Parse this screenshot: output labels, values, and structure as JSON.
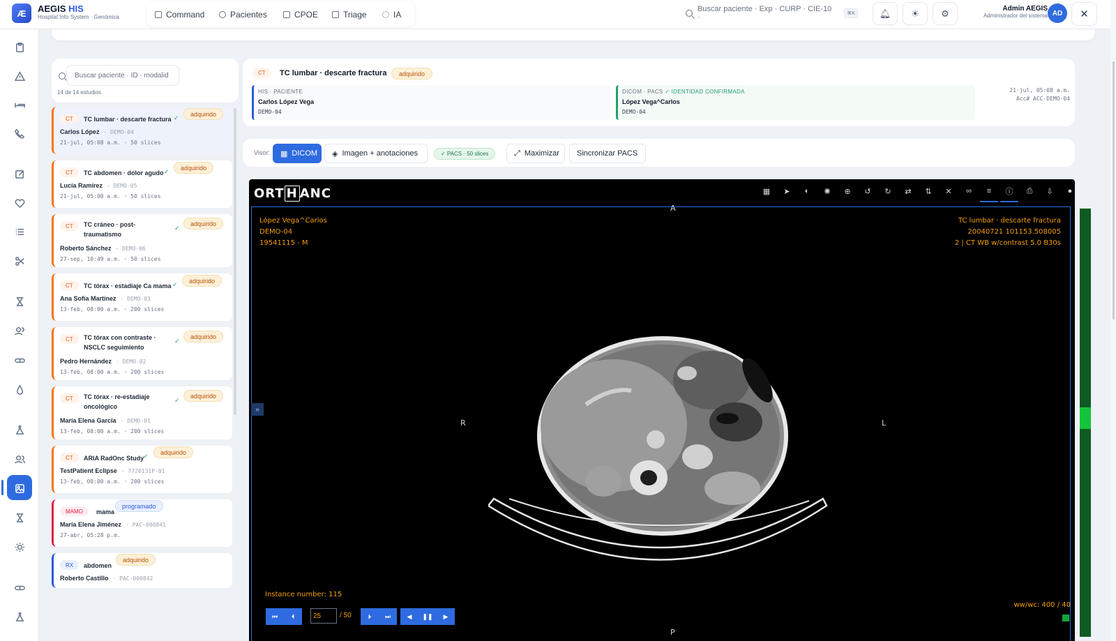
{
  "app": {
    "logo_mark": "Æ",
    "name_prefix": "AEGIS",
    "name_suffix": "HIS",
    "subtitle": "Hospital Info System · Genómica"
  },
  "nav_tabs": [
    {
      "label": "Command"
    },
    {
      "label": "Pacientes"
    },
    {
      "label": "CPOE"
    },
    {
      "label": "Triage"
    },
    {
      "label": "IA"
    }
  ],
  "search": {
    "placeholder": "Buscar paciente · Exp · CURP · CIE-10 ·",
    "shortcut": "⌘K"
  },
  "user": {
    "name": "Admin AEGIS",
    "role": "Administrador del sistema",
    "initials": "AD"
  },
  "close_label": "✕",
  "rail_icons": [
    "clipboard-icon",
    "alert-icon",
    "bed-icon",
    "phone-icon",
    "edit-icon",
    "heart-icon",
    "list-icon",
    "scissors-icon",
    "hourglass-icon",
    "users-icon",
    "pill-icon",
    "drop-icon",
    "flask-icon",
    "group-icon",
    "image-icon",
    "hourglass-icon-2",
    "sun-icon",
    "pill-icon-2",
    "flask-icon-2"
  ],
  "study_list": {
    "search_placeholder": "Buscar paciente · ID · modalid",
    "count": "14 de 14 estudios",
    "items": [
      {
        "mod": "CT",
        "title": "TC lumbar · descarte fractura",
        "status": "adquirido",
        "patient": "Carlos López",
        "pid": "DEMO-04",
        "date": "21-jul, 05:08 a.m.",
        "slices": "50 slices"
      },
      {
        "mod": "CT",
        "title": "TC abdomen · dolor agudo",
        "status": "adquirido",
        "patient": "Lucía Ramírez",
        "pid": "DEMO-05",
        "date": "21-jul, 05:08 a.m.",
        "slices": "50 slices"
      },
      {
        "mod": "CT",
        "title": "TC cráneo · post-",
        "title2": "traumatismo",
        "status": "adquirido",
        "patient": "Roberto Sánchez",
        "pid": "DEMO-06",
        "date": "27-sep, 10:49 a.m.",
        "slices": "50 slices"
      },
      {
        "mod": "CT",
        "title": "TC tórax · estadiaje Ca mama",
        "status": "adquirido",
        "patient": "Ana Sofía Martínez",
        "pid": "DEMO-03",
        "date": "13-feb, 08:00 a.m.",
        "slices": "200 slices"
      },
      {
        "mod": "CT",
        "title": "TC tórax con contraste ·",
        "title2": "NSCLC seguimiento",
        "status": "adquirido",
        "patient": "Pedro Hernández",
        "pid": "DEMO-02",
        "date": "13-feb, 08:00 a.m.",
        "slices": "200 slices"
      },
      {
        "mod": "CT",
        "title": "TC tórax · re-estadiaje",
        "title2": "oncológico",
        "status": "adquirido",
        "patient": "María Elena García",
        "pid": "DEMO-01",
        "date": "13-feb, 08:00 a.m.",
        "slices": "200 slices"
      },
      {
        "mod": "CT",
        "title": "ARIA RadOnc Study",
        "status": "adquirido",
        "patient": "TestPatient Eclipse",
        "pid": "7720131P-01",
        "date": "13-feb, 08:00 a.m.",
        "slices": "200 slices"
      },
      {
        "mod": "MAMO",
        "title": "mama",
        "status": "programado",
        "patient": "María Elena Jiménez",
        "pid": "PAC-000841",
        "date": "27-abr, 05:28 p.m.",
        "slices": ""
      },
      {
        "mod": "RX",
        "title": "abdomen",
        "status": "adquirido",
        "patient": "Roberto Castillo",
        "pid": "PAC-000842",
        "date": "",
        "slices": ""
      }
    ]
  },
  "header": {
    "mod": "CT",
    "title": "TC lumbar · descarte fractura",
    "status": "adquirido",
    "his_label": "HIS · PACIENTE",
    "his_name": "Carlos López Vega",
    "his_id": "DEMO-04",
    "dicom_label": "DICOM · PACS",
    "dicom_ok": "✓ IDENTIDAD CONFIRMADA",
    "dicom_name": "López Vega^Carlos",
    "dicom_id": "DEMO-04",
    "date": "21-jul, 05:08 a.m.",
    "acc": "Acc# ACC-DEMO-04"
  },
  "toolbar": {
    "label": "Visor:",
    "dicom": "DICOM",
    "image_ann": "Imagen + anotaciones",
    "pacs": "✓ PACS · 50 slices",
    "maximize": "Maximizar",
    "sync": "Sincronizar PACS"
  },
  "viewer": {
    "brand_a": "ORT",
    "brand_h": "H",
    "brand_b": "ANC",
    "tl1": "López Vega^Carlos",
    "tl2": "DEMO-04",
    "tl3": "19541115 - M",
    "tr1": "TC lumbar · descarte fractura",
    "tr2": "20040721 101153.508005",
    "tr3": "2 | CT WB w/contrast 5.0 B30s",
    "orient_top": "A",
    "orient_bottom": "P",
    "orient_left": "R",
    "orient_right": "L",
    "instance": "Instance number: 115",
    "wwwc": "ww/wc: 400 / 40",
    "frame": "25",
    "frame_total": "/ 50"
  }
}
